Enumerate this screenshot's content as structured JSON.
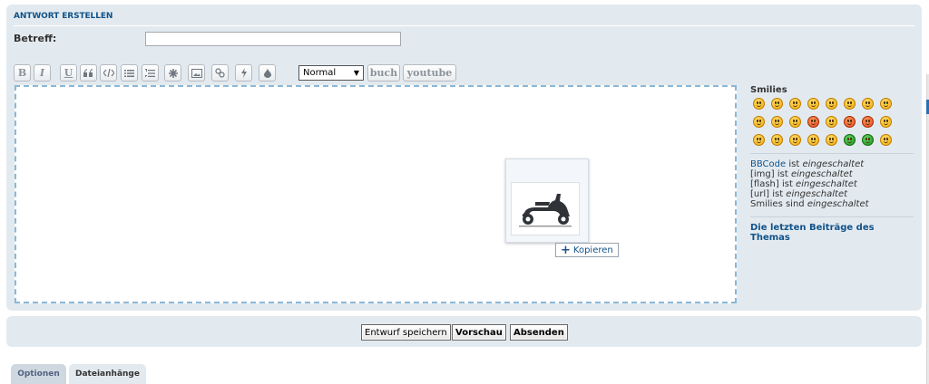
{
  "form": {
    "title": "ANTWORT ERSTELLEN",
    "subject_label": "Betreff:",
    "subject_value": ""
  },
  "toolbar": {
    "buttons": [
      {
        "label": "B",
        "icon": "bold-icon"
      },
      {
        "label": "I",
        "icon": "italic-icon"
      },
      {
        "label": "U",
        "icon": "underline-icon"
      },
      {
        "label": "",
        "icon": "quote-icon"
      },
      {
        "label": "",
        "icon": "code-icon"
      },
      {
        "label": "",
        "icon": "unordered-list-icon"
      },
      {
        "label": "",
        "icon": "ordered-list-icon"
      },
      {
        "label": "",
        "icon": "list-item-icon"
      },
      {
        "label": "",
        "icon": "image-icon"
      },
      {
        "label": "",
        "icon": "link-icon"
      },
      {
        "label": "",
        "icon": "flash-icon"
      },
      {
        "label": "",
        "icon": "color-icon"
      }
    ],
    "font_size_selected": "Normal",
    "custom_buttons": [
      "buch",
      "youtube"
    ]
  },
  "drag_overlay": {
    "image_icon": "scooter-icon",
    "copy_label": "Kopieren"
  },
  "sidebar": {
    "smilies_title": "Smilies",
    "status": {
      "bbcode_link": "BBCode",
      "bbcode_text": " ist ",
      "bbcode_state": "eingeschaltet",
      "img_text": "[img] ist ",
      "img_state": "eingeschaltet",
      "flash_text": "[flash] ist ",
      "flash_state": "eingeschaltet",
      "url_text": "[url] ist ",
      "url_state": "eingeschaltet",
      "smilies_text": "Smilies sind ",
      "smilies_state": "eingeschaltet"
    },
    "recent_posts_link": "Die letzten Beiträge des Themas"
  },
  "actions": {
    "save_draft": "Entwurf speichern",
    "preview": "Vorschau",
    "submit": "Absenden"
  },
  "tabs": [
    {
      "label": "Optionen",
      "active": false
    },
    {
      "label": "Dateianhänge",
      "active": true
    }
  ]
}
